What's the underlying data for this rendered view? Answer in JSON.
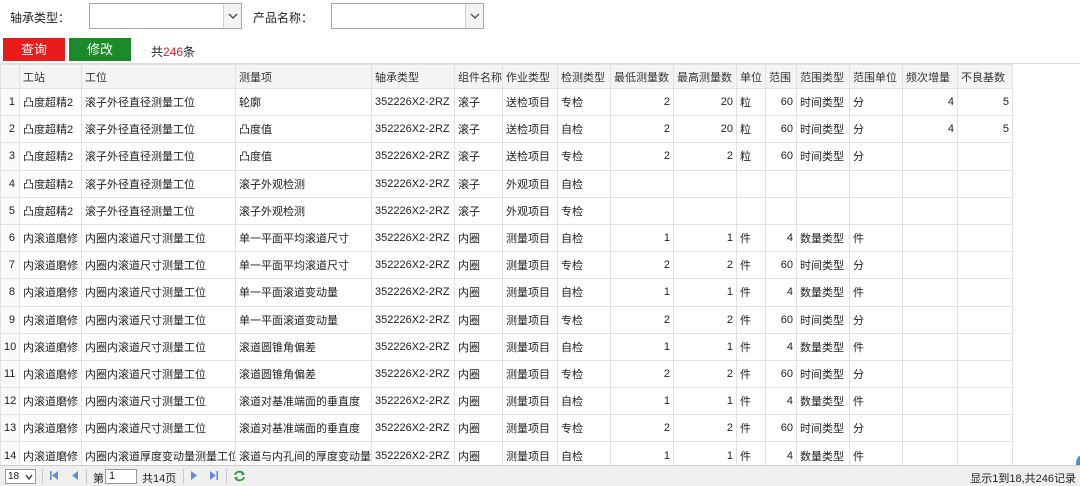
{
  "filters": {
    "bearing_type_label": "轴承类型：",
    "bearing_type_value": "",
    "product_name_label": "产品名称：",
    "product_name_value": ""
  },
  "actions": {
    "query_label": "查询",
    "edit_label": "修改",
    "total_prefix": "共",
    "total_count": "246",
    "total_suffix": "条"
  },
  "table": {
    "columns": [
      "",
      "工站",
      "工位",
      "测量项",
      "轴承类型",
      "组件名称",
      "作业类型",
      "检测类型",
      "最低测量数",
      "最高测量数",
      "单位",
      "范围",
      "范围类型",
      "范围单位",
      "频次增量",
      "不良基数"
    ],
    "rows": [
      [
        "1",
        "凸度超精2",
        "滚子外径直径测量工位",
        "轮廓",
        "352226X2-2RZ",
        "滚子",
        "送检项目",
        "专检",
        "2",
        "20",
        "粒",
        "60",
        "时间类型",
        "分",
        "4",
        "5"
      ],
      [
        "2",
        "凸度超精2",
        "滚子外径直径测量工位",
        "凸度值",
        "352226X2-2RZ",
        "滚子",
        "送检项目",
        "自检",
        "2",
        "20",
        "粒",
        "60",
        "时间类型",
        "分",
        "4",
        "5"
      ],
      [
        "3",
        "凸度超精2",
        "滚子外径直径测量工位",
        "凸度值",
        "352226X2-2RZ",
        "滚子",
        "送检项目",
        "专检",
        "2",
        "2",
        "粒",
        "60",
        "时间类型",
        "分",
        "",
        ""
      ],
      [
        "4",
        "凸度超精2",
        "滚子外径直径测量工位",
        "滚子外观检测",
        "352226X2-2RZ",
        "滚子",
        "外观项目",
        "自检",
        "",
        "",
        "",
        "",
        "",
        "",
        "",
        ""
      ],
      [
        "5",
        "凸度超精2",
        "滚子外径直径测量工位",
        "滚子外观检测",
        "352226X2-2RZ",
        "滚子",
        "外观项目",
        "专检",
        "",
        "",
        "",
        "",
        "",
        "",
        "",
        ""
      ],
      [
        "6",
        "内滚道磨修",
        "内圈内滚道尺寸测量工位",
        "单一平面平均滚道尺寸",
        "352226X2-2RZ",
        "内圈",
        "测量项目",
        "自检",
        "1",
        "1",
        "件",
        "4",
        "数量类型",
        "件",
        "",
        ""
      ],
      [
        "7",
        "内滚道磨修",
        "内圈内滚道尺寸测量工位",
        "单一平面平均滚道尺寸",
        "352226X2-2RZ",
        "内圈",
        "测量项目",
        "专检",
        "2",
        "2",
        "件",
        "60",
        "时间类型",
        "分",
        "",
        ""
      ],
      [
        "8",
        "内滚道磨修",
        "内圈内滚道尺寸测量工位",
        "单一平面滚道变动量",
        "352226X2-2RZ",
        "内圈",
        "测量项目",
        "自检",
        "1",
        "1",
        "件",
        "4",
        "数量类型",
        "件",
        "",
        ""
      ],
      [
        "9",
        "内滚道磨修",
        "内圈内滚道尺寸测量工位",
        "单一平面滚道变动量",
        "352226X2-2RZ",
        "内圈",
        "测量项目",
        "专检",
        "2",
        "2",
        "件",
        "60",
        "时间类型",
        "分",
        "",
        ""
      ],
      [
        "10",
        "内滚道磨修",
        "内圈内滚道尺寸测量工位",
        "滚道圆锥角偏差",
        "352226X2-2RZ",
        "内圈",
        "测量项目",
        "自检",
        "1",
        "1",
        "件",
        "4",
        "数量类型",
        "件",
        "",
        ""
      ],
      [
        "11",
        "内滚道磨修",
        "内圈内滚道尺寸测量工位",
        "滚道圆锥角偏差",
        "352226X2-2RZ",
        "内圈",
        "测量项目",
        "专检",
        "2",
        "2",
        "件",
        "60",
        "时间类型",
        "分",
        "",
        ""
      ],
      [
        "12",
        "内滚道磨修",
        "内圈内滚道尺寸测量工位",
        "滚道对基准端面的垂直度",
        "352226X2-2RZ",
        "内圈",
        "测量项目",
        "自检",
        "1",
        "1",
        "件",
        "4",
        "数量类型",
        "件",
        "",
        ""
      ],
      [
        "13",
        "内滚道磨修",
        "内圈内滚道尺寸测量工位",
        "滚道对基准端面的垂直度",
        "352226X2-2RZ",
        "内圈",
        "测量项目",
        "专检",
        "2",
        "2",
        "件",
        "60",
        "时间类型",
        "分",
        "",
        ""
      ],
      [
        "14",
        "内滚道磨修",
        "内圈内滚道厚度变动量测量工位",
        "滚道与内孔间的厚度变动量",
        "352226X2-2RZ",
        "内圈",
        "测量项目",
        "自检",
        "1",
        "1",
        "件",
        "4",
        "数量类型",
        "件",
        "",
        ""
      ]
    ]
  },
  "pager": {
    "page_size": "18",
    "page_prefix": "第",
    "page_value": "1",
    "total_pages": "共14页",
    "info": "显示1到18,共246记录"
  },
  "colors": {
    "query_button": "#e81a1a",
    "edit_button": "#1b8a2a",
    "count_highlight": "#e0202a",
    "pager_nav": "#5a8fd6",
    "refresh_icon": "#2a9a3a"
  }
}
